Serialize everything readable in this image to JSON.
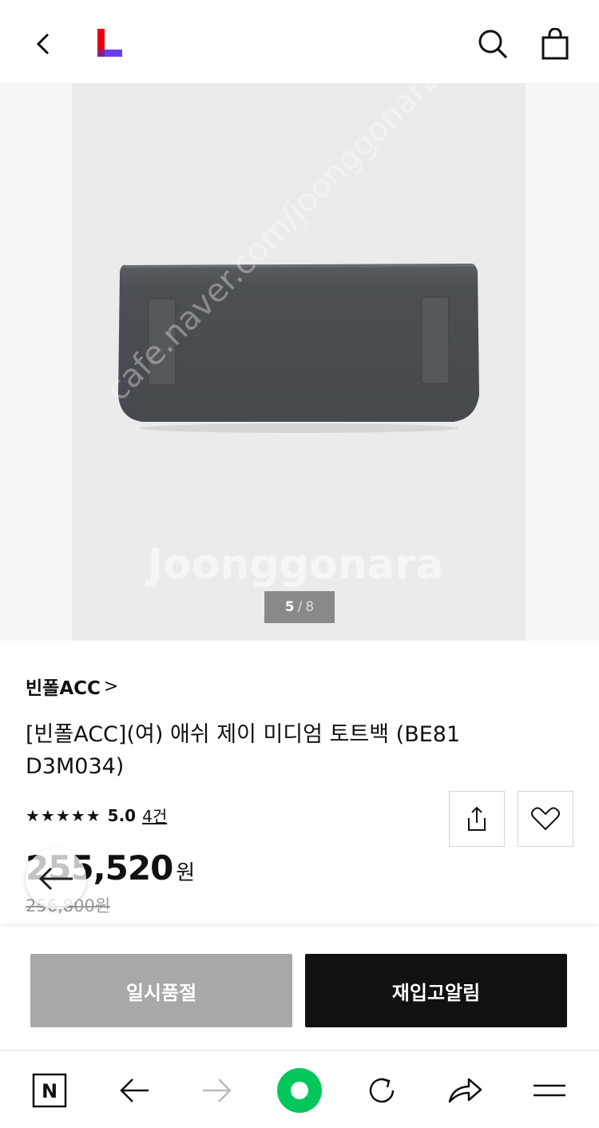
{
  "header": {
    "back_icon": "chevron-left-icon",
    "logo": "lotte-on-logo",
    "search_icon": "search-icon",
    "cart_icon": "shopping-bag-icon"
  },
  "gallery": {
    "current": "5",
    "separator": "/",
    "total": "8"
  },
  "product": {
    "brand": "빈폴ACC",
    "brand_chevron": ">",
    "title": "[빈폴ACC](여) 애쉬 제이 미디엄 토트백 (BE81 D3M034)",
    "stars": "★★★★★",
    "rating": "5.0",
    "review_count": "4건",
    "price": "255,520",
    "price_unit": "원",
    "original_price": "256,800원"
  },
  "actions": {
    "share_icon": "share-icon",
    "wish_icon": "heart-icon"
  },
  "buttons": {
    "soldout": "일시품절",
    "restock": "재입고알림"
  },
  "browser_nav": [
    "naver-n-icon",
    "back-arrow-icon",
    "forward-arrow-icon",
    "green-dot-home-icon",
    "refresh-icon",
    "share-arrow-icon",
    "menu-icon"
  ],
  "colors": {
    "logo_red": "#e60012",
    "logo_purple": "#6a3df5",
    "naver_green": "#03c75a",
    "soldout_gray": "#a8a8a8",
    "restock_black": "#111111"
  }
}
